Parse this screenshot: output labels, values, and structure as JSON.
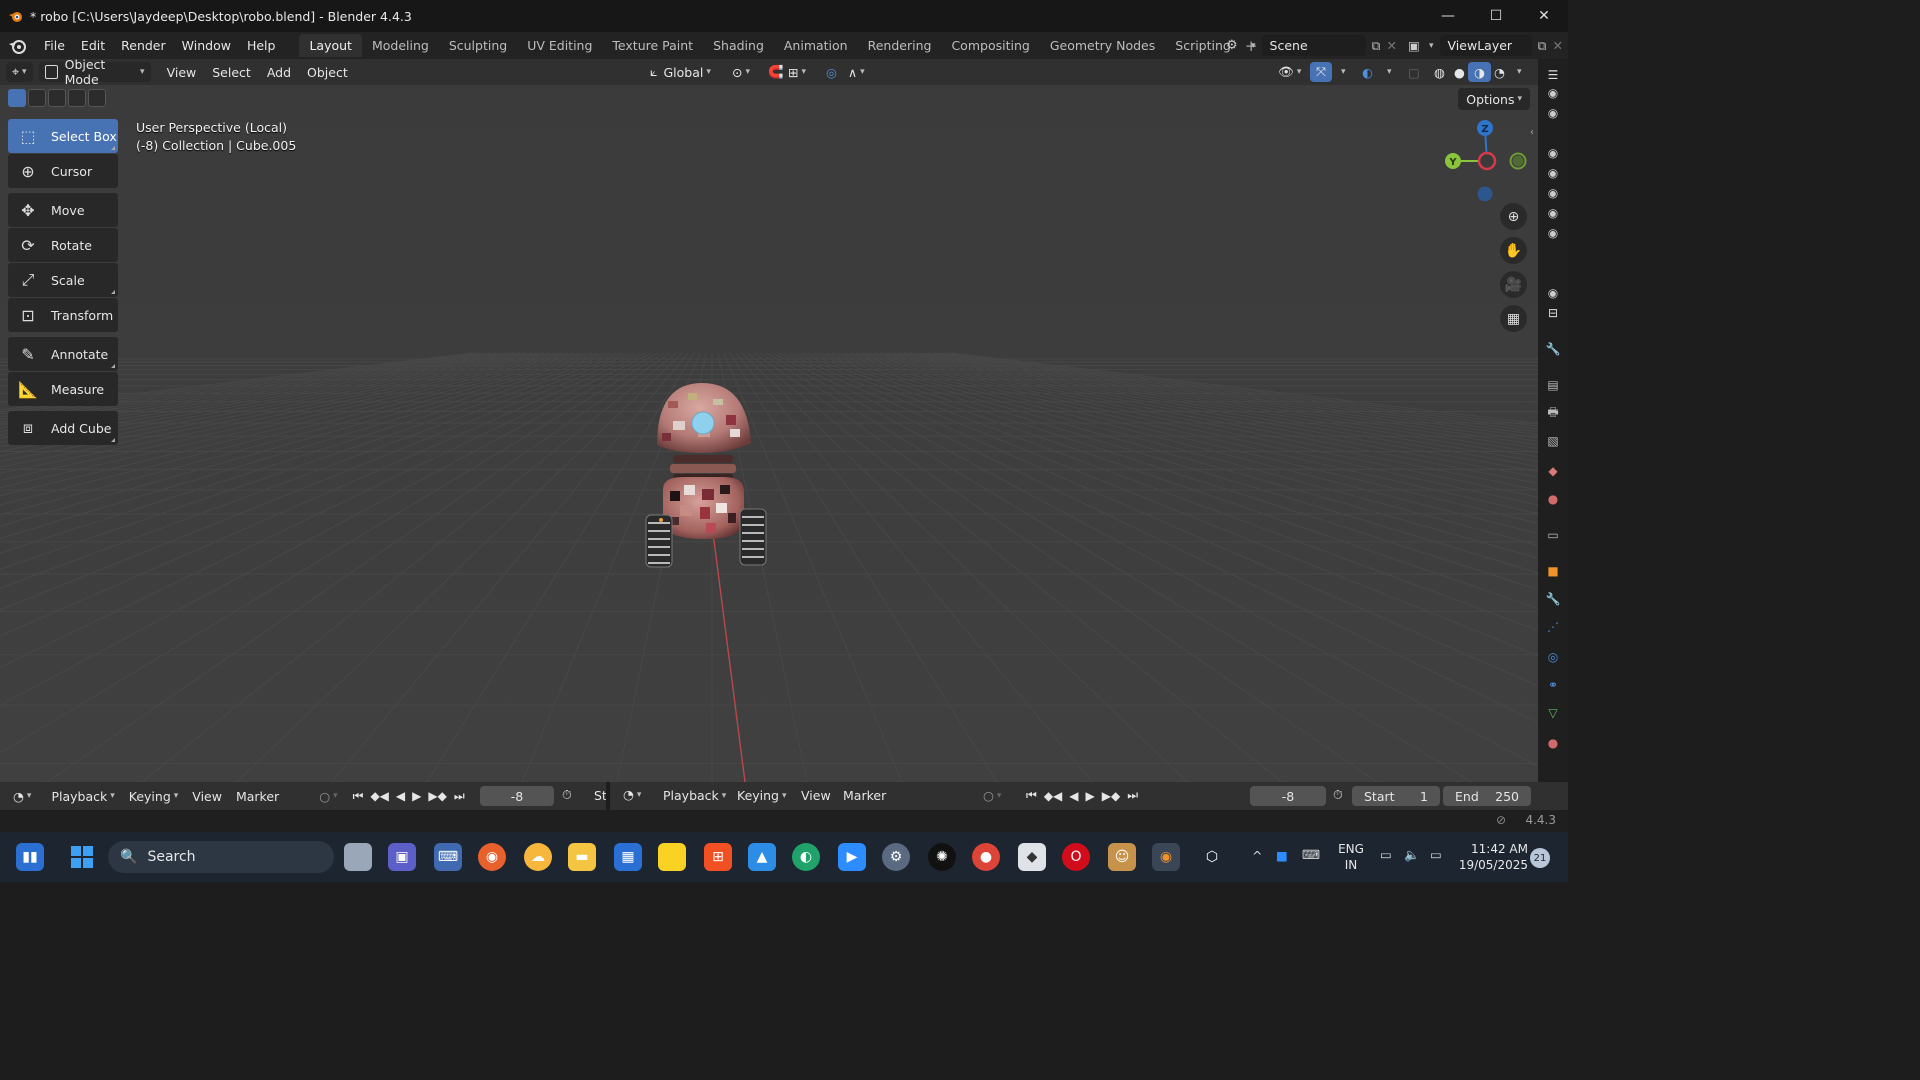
{
  "window": {
    "title": "* robo [C:\\Users\\Jaydeep\\Desktop\\robo.blend] - Blender 4.4.3",
    "minimize": "—",
    "maximize": "☐",
    "close": "✕"
  },
  "menu": [
    "File",
    "Edit",
    "Render",
    "Window",
    "Help"
  ],
  "workspaces": [
    "Layout",
    "Modeling",
    "Sculpting",
    "UV Editing",
    "Texture Paint",
    "Shading",
    "Animation",
    "Rendering",
    "Compositing",
    "Geometry Nodes",
    "Scripting"
  ],
  "active_workspace": "Layout",
  "scene": {
    "name": "Scene",
    "view_layer": "ViewLayer"
  },
  "viewport_header": {
    "mode": "Object Mode",
    "menus": [
      "View",
      "Select",
      "Add",
      "Object"
    ],
    "orientation": "Global"
  },
  "viewport": {
    "perspective": "User Perspective (Local)",
    "collection": "(-8) Collection | Cube.005",
    "options": "Options"
  },
  "tools": [
    {
      "label": "Select Box",
      "icon": "select-box-icon",
      "active": true
    },
    {
      "label": "Cursor",
      "icon": "cursor-icon"
    },
    {
      "label": "Move",
      "icon": "move-icon"
    },
    {
      "label": "Rotate",
      "icon": "rotate-icon"
    },
    {
      "label": "Scale",
      "icon": "scale-icon"
    },
    {
      "label": "Transform",
      "icon": "transform-icon"
    },
    {
      "label": "Annotate",
      "icon": "annotate-icon"
    },
    {
      "label": "Measure",
      "icon": "measure-icon"
    },
    {
      "label": "Add Cube",
      "icon": "add-cube-icon"
    }
  ],
  "gizmo": {
    "z": "Z",
    "y": "Y"
  },
  "timeline_left": {
    "playback": "Playback",
    "keying": "Keying",
    "view": "View",
    "marker": "Marker",
    "frame": "-8",
    "start_trunc": "St"
  },
  "timeline_right": {
    "playback": "Playback",
    "keying": "Keying",
    "view": "View",
    "marker": "Marker",
    "frame": "-8",
    "start_label": "Start",
    "start_value": "1",
    "end_label": "End",
    "end_value": "250"
  },
  "status": {
    "version": "4.4.3"
  },
  "taskbar": {
    "search": "Search",
    "lang_line1": "ENG",
    "lang_line2": "IN",
    "time": "11:42 AM",
    "date": "19/05/2025",
    "notifications": "21"
  },
  "colors": {
    "accent": "#4772b3",
    "axis_x": "#d8394a",
    "axis_y": "#8ac33c",
    "axis_z": "#2f74c8"
  }
}
